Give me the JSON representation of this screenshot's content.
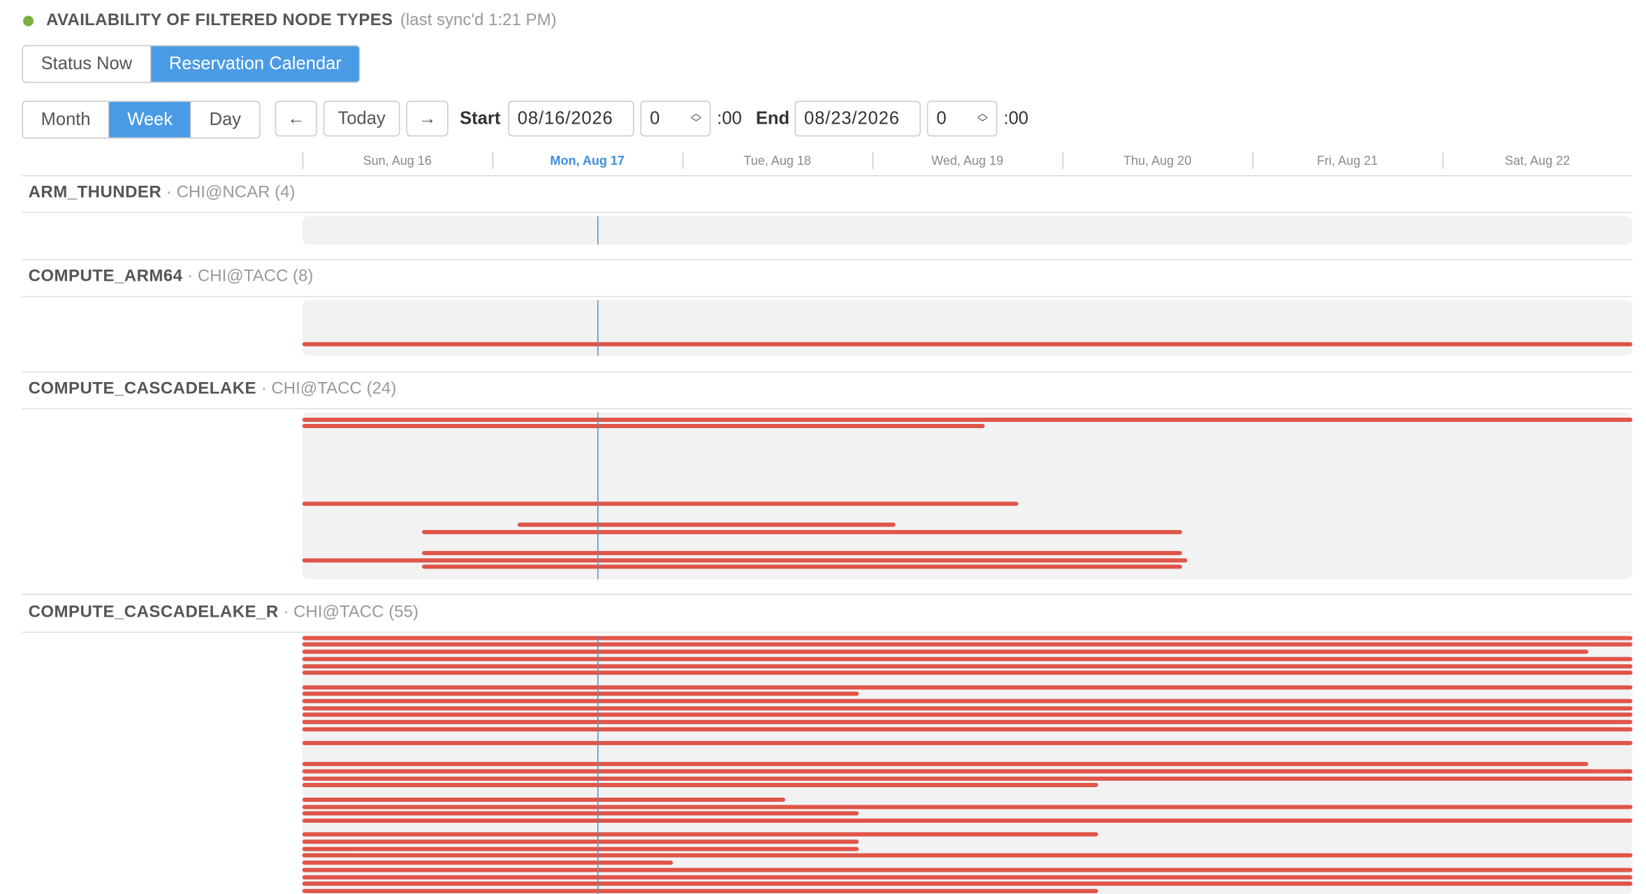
{
  "header": {
    "title": "AVAILABILITY OF FILTERED NODE TYPES",
    "sync": "(last sync'd 1:21 PM)",
    "status_color": "#7cad3e"
  },
  "view_tabs": [
    {
      "label": "Status Now",
      "active": false
    },
    {
      "label": "Reservation Calendar",
      "active": true
    }
  ],
  "range_tabs": [
    {
      "label": "Month",
      "active": false
    },
    {
      "label": "Week",
      "active": true
    },
    {
      "label": "Day",
      "active": false
    }
  ],
  "nav": {
    "prev_icon": "←",
    "today_label": "Today",
    "next_icon": "→",
    "start_label": "Start",
    "start_date": "08/16/2026",
    "start_hour": "0",
    "start_suffix": ":00",
    "end_label": "End",
    "end_date": "08/23/2026",
    "end_hour": "0",
    "end_suffix": ":00"
  },
  "days": [
    "Sun, Aug 16",
    "Mon, Aug 17",
    "Tue, Aug 18",
    "Wed, Aug 19",
    "Thu, Aug 20",
    "Fri, Aug 21",
    "Sat, Aug 22"
  ],
  "today_index": 1,
  "now_day_offset": 1.55,
  "colors": {
    "accent": "#4a9be5",
    "reserved": "#e05549",
    "now_line": "#4a90d9",
    "track": "#f2f2f2"
  },
  "groups": [
    {
      "name": "ARM_THUNDER",
      "site": "· CHI@NCAR (4)",
      "reservations": []
    },
    {
      "name": "COMPUTE_ARM64",
      "site": "· CHI@TACC (8)",
      "reservations": [
        {
          "row": 5,
          "start": 0,
          "end": 7
        }
      ]
    },
    {
      "name": "COMPUTE_CASCADELAKE",
      "site": "· CHI@TACC (24)",
      "reservations": [
        {
          "row": 1,
          "start": 0,
          "end": 7
        },
        {
          "row": 2,
          "start": 0,
          "end": 3.59
        },
        {
          "row": 13,
          "start": 0,
          "end": 3.77
        },
        {
          "row": 16,
          "start": 1.13,
          "end": 3.12
        },
        {
          "row": 17,
          "start": 0.63,
          "end": 4.63
        },
        {
          "row": 20,
          "start": 0.63,
          "end": 4.63
        },
        {
          "row": 21,
          "start": 0,
          "end": 4.66
        },
        {
          "row": 22,
          "start": 0.63,
          "end": 4.63
        }
      ]
    },
    {
      "name": "COMPUTE_CASCADELAKE_R",
      "site": "· CHI@TACC (55)",
      "reservations": [
        {
          "row": 1,
          "start": 0,
          "end": 7
        },
        {
          "row": 2,
          "start": 0,
          "end": 7
        },
        {
          "row": 3,
          "start": 0,
          "end": 6.77
        },
        {
          "row": 4,
          "start": 0,
          "end": 7
        },
        {
          "row": 5,
          "start": 0,
          "end": 7
        },
        {
          "row": 6,
          "start": 0,
          "end": 7
        },
        {
          "row": 8,
          "start": 0,
          "end": 7
        },
        {
          "row": 9,
          "start": 0,
          "end": 2.93
        },
        {
          "row": 10,
          "start": 0,
          "end": 7
        },
        {
          "row": 11,
          "start": 0,
          "end": 7
        },
        {
          "row": 12,
          "start": 0,
          "end": 7
        },
        {
          "row": 13,
          "start": 0,
          "end": 7
        },
        {
          "row": 14,
          "start": 0,
          "end": 7
        },
        {
          "row": 16,
          "start": 0,
          "end": 7
        },
        {
          "row": 19,
          "start": 0,
          "end": 6.77
        },
        {
          "row": 20,
          "start": 0,
          "end": 7
        },
        {
          "row": 21,
          "start": 0,
          "end": 7
        },
        {
          "row": 22,
          "start": 0,
          "end": 4.19
        },
        {
          "row": 24,
          "start": 0,
          "end": 2.54
        },
        {
          "row": 25,
          "start": 0,
          "end": 7
        },
        {
          "row": 26,
          "start": 0,
          "end": 2.93
        },
        {
          "row": 27,
          "start": 0,
          "end": 7
        },
        {
          "row": 29,
          "start": 0,
          "end": 4.19
        },
        {
          "row": 30,
          "start": 0,
          "end": 2.93
        },
        {
          "row": 31,
          "start": 0,
          "end": 2.93
        },
        {
          "row": 32,
          "start": 0,
          "end": 7
        },
        {
          "row": 33,
          "start": 0,
          "end": 1.95
        },
        {
          "row": 34,
          "start": 0,
          "end": 7
        },
        {
          "row": 35,
          "start": 0,
          "end": 7
        },
        {
          "row": 36,
          "start": 0,
          "end": 7
        },
        {
          "row": 37,
          "start": 0,
          "end": 4.19
        }
      ]
    }
  ]
}
